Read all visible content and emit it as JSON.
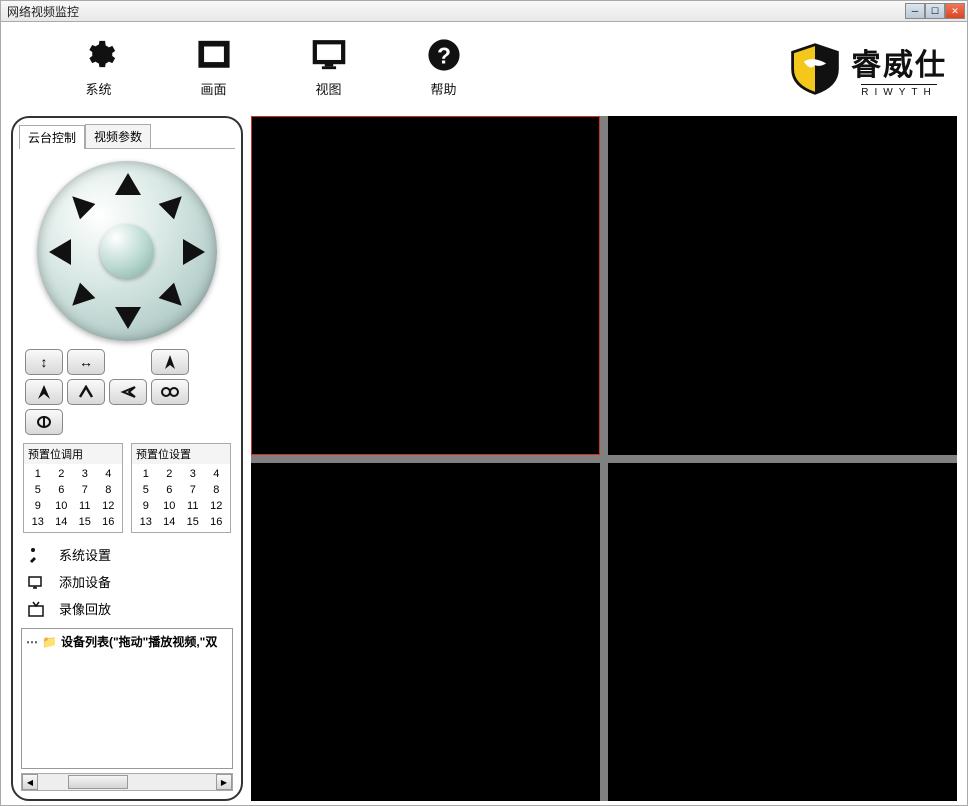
{
  "window": {
    "title": "网络视频监控"
  },
  "toolbar": {
    "system": "系统",
    "screen": "画面",
    "view": "视图",
    "help": "帮助"
  },
  "logo": {
    "cn": "睿威仕",
    "en": "RIWYTH"
  },
  "tabs": {
    "ptz": "云台控制",
    "videoParams": "视频参数"
  },
  "preset": {
    "recall_title": "预置位调用",
    "set_title": "预置位设置",
    "cells": [
      "1",
      "2",
      "3",
      "4",
      "5",
      "6",
      "7",
      "8",
      "9",
      "10",
      "11",
      "12",
      "13",
      "14",
      "15",
      "16"
    ]
  },
  "menu": {
    "systemSettings": "系统设置",
    "addDevice": "添加设备",
    "playback": "录像回放"
  },
  "tree": {
    "root": "设备列表(\"拖动\"播放视频,\"双"
  }
}
